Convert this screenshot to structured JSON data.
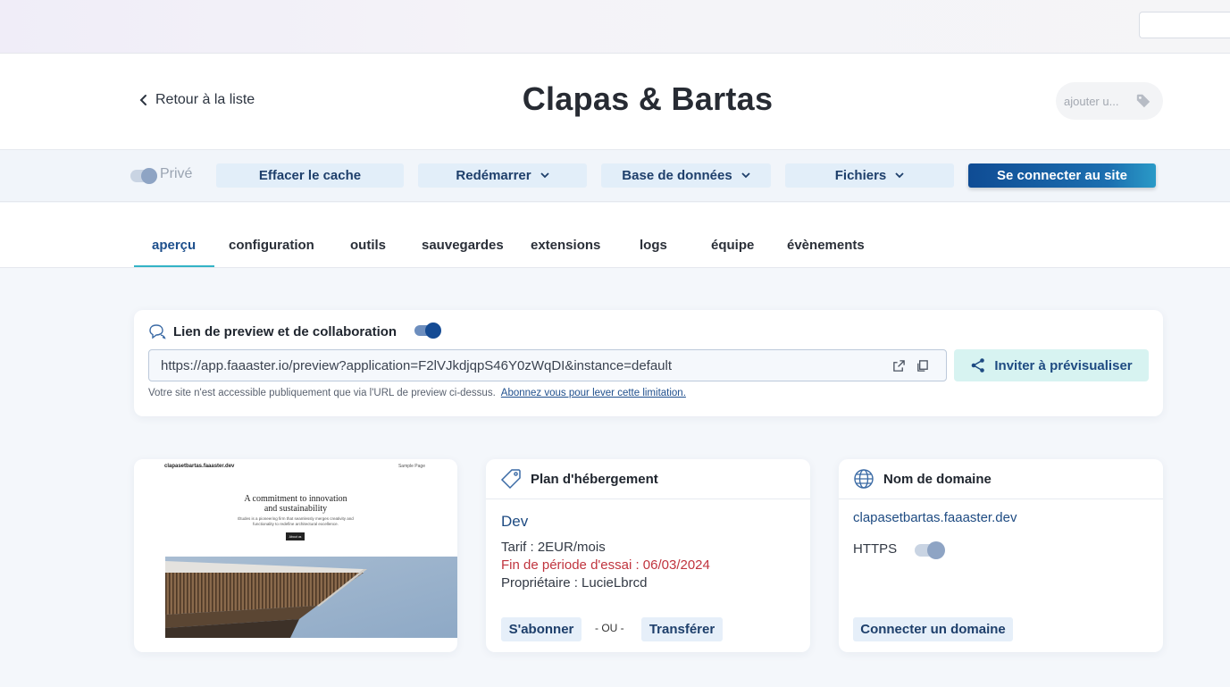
{
  "header": {
    "back_label": "Retour à la liste",
    "title": "Clapas & Bartas",
    "tag_placeholder": "ajouter u..."
  },
  "actions": {
    "prive_label": "Privé",
    "clear_cache": "Effacer le cache",
    "restart": "Redémarrer",
    "database": "Base de données",
    "files": "Fichiers",
    "connect": "Se connecter au site"
  },
  "tabs": [
    {
      "label": "aperçu",
      "active": true
    },
    {
      "label": "configuration",
      "active": false
    },
    {
      "label": "outils",
      "active": false
    },
    {
      "label": "sauvegardes",
      "active": false
    },
    {
      "label": "extensions",
      "active": false
    },
    {
      "label": "logs",
      "active": false
    },
    {
      "label": "équipe",
      "active": false
    },
    {
      "label": "évènements",
      "active": false
    }
  ],
  "preview": {
    "title": "Lien de preview et de collaboration",
    "url": "https://app.faaaster.io/preview?application=F2lVJkdjqpS46Y0zWqDI&instance=default",
    "invite_label": "Inviter à prévisualiser",
    "note": "Votre site n'est accessible publiquement que via l'URL de preview ci-dessus.",
    "note_link": "Abonnez vous pour lever cette limitation."
  },
  "thumbnail": {
    "site_name": "clapasetbartas.faaaster.dev",
    "nav_item": "Sample Page",
    "headline_1": "A commitment to innovation",
    "headline_2": "and sustainability",
    "subtext": "Études is a pioneering firm that seamlessly merges creativity and functionality to redefine architectural excellence.",
    "button": "About us"
  },
  "plan": {
    "title": "Plan d'hébergement",
    "name": "Dev",
    "tarif": "Tarif : 2EUR/mois",
    "trial_end": "Fin de période d'essai : 06/03/2024",
    "owner": "Propriétaire : LucieLbrcd",
    "subscribe": "S'abonner",
    "or": "- OU -",
    "transfer": "Transférer"
  },
  "domain": {
    "title": "Nom de domaine",
    "url": "clapasetbartas.faaaster.dev",
    "https_label": "HTTPS",
    "connect": "Connecter un domaine"
  },
  "colors": {
    "primary": "#1e4b82",
    "accent": "#33b3c6",
    "warning": "#c0343e"
  }
}
